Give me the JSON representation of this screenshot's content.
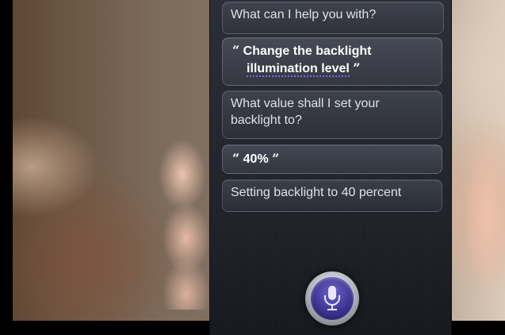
{
  "conversation": {
    "siri_prompt_1": "What can I help you with?",
    "user_request_line1": "Change the backlight",
    "user_request_line2": "illumination level",
    "siri_question_line1": "What value shall I set your",
    "siri_question_line2": "backlight to?",
    "user_answer": "40%",
    "siri_confirmation": "Setting backlight to 40 percent"
  },
  "quotes": {
    "open": "“",
    "close": "”"
  },
  "mic": {
    "icon": "microphone-icon",
    "accent": "#3e3594"
  }
}
